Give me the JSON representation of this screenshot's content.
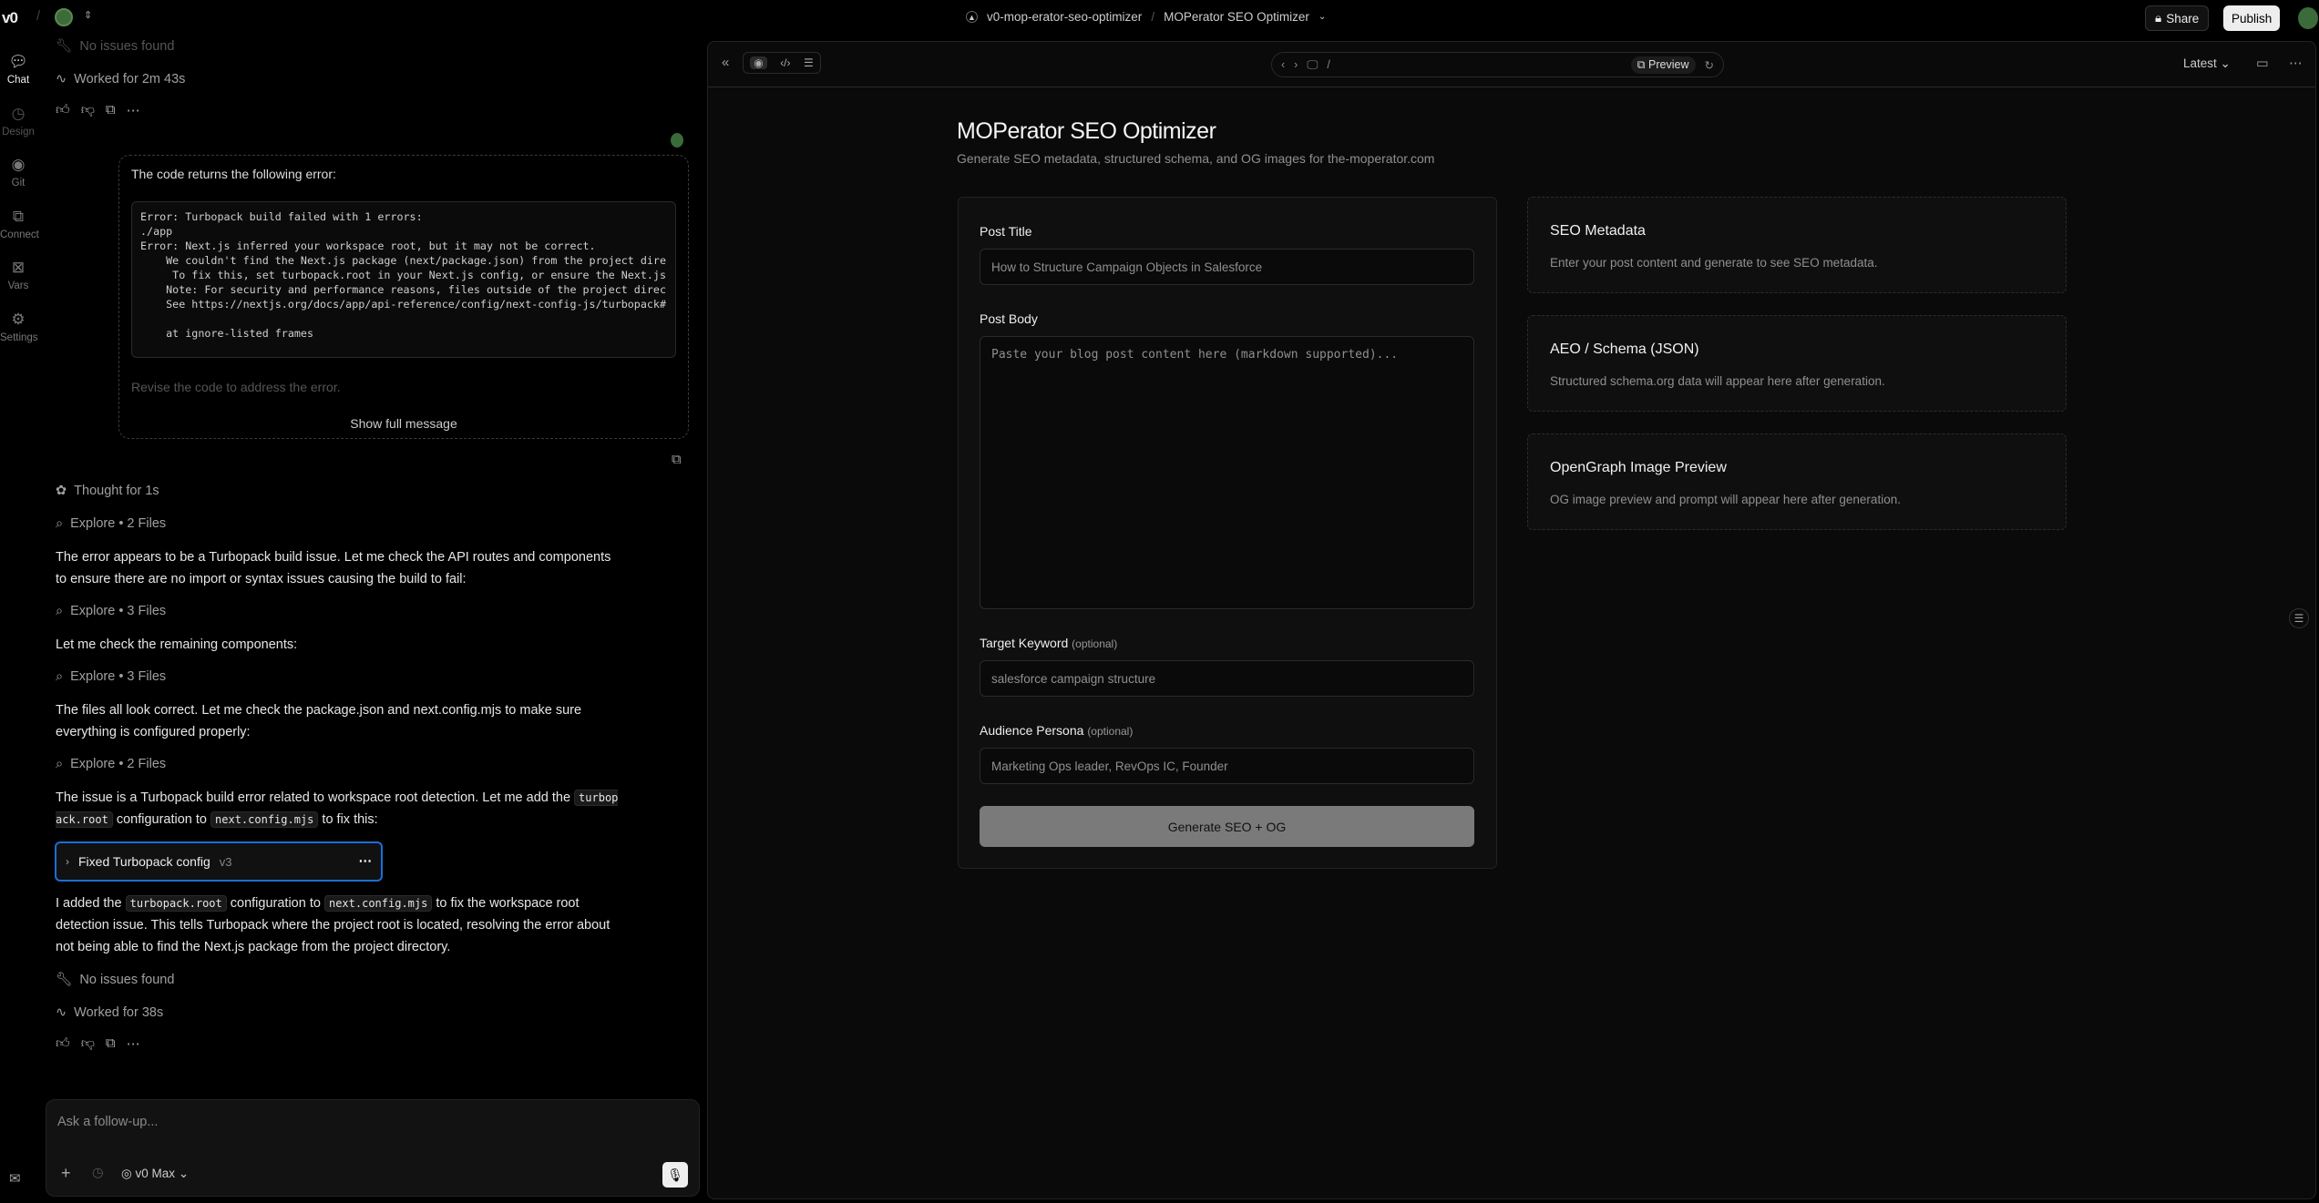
{
  "topbar": {
    "logo": "v0",
    "project": "v0-mop-erator-seo-optimizer",
    "page": "MOPerator SEO Optimizer",
    "share": "Share",
    "publish": "Publish"
  },
  "rail": [
    {
      "label": "Chat",
      "icon": "chat-icon"
    },
    {
      "label": "Design",
      "icon": "design-icon"
    },
    {
      "label": "Git",
      "icon": "github-icon"
    },
    {
      "label": "Connect",
      "icon": "connect-icon"
    },
    {
      "label": "Vars",
      "icon": "vars-icon"
    },
    {
      "label": "Settings",
      "icon": "gear-icon"
    }
  ],
  "chat": {
    "no_issues_top": "No issues found",
    "worked_top": "Worked for 2m 43s",
    "user_msg": {
      "intro": "The code returns the following error:",
      "error_lines": [
        "Error: Turbopack build failed with 1 errors:",
        "./app",
        "Error: Next.js inferred your workspace root, but it may not be correct.",
        "    We couldn't find the Next.js package (next/package.json) from the project dire",
        "     To fix this, set turbopack.root in your Next.js config, or ensure the Next.js",
        "    Note: For security and performance reasons, files outside of the project direc",
        "    See https://nextjs.org/docs/app/api-reference/config/next-config-js/turbopack#",
        "",
        "    at ignore-listed frames"
      ],
      "revise": "Revise the code to address the error.",
      "show_full": "Show full message"
    },
    "thought": "Thought for 1s",
    "explore1": "Explore • 2 Files",
    "para1": "The error appears to be a Turbopack build issue. Let me check the API routes and components to ensure there are no import or syntax issues causing the build to fail:",
    "explore2": "Explore • 3 Files",
    "para2": "Let me check the remaining components:",
    "explore3": "Explore • 3 Files",
    "para3": "The files all look correct. Let me check the package.json and next.config.mjs to make sure everything is configured properly:",
    "explore4": "Explore • 2 Files",
    "para4a": "The issue is a Turbopack build error related to workspace root detection. Let me add the ",
    "para4code1": "turbopack.root",
    "para4b": " configuration to ",
    "para4code2": "next.config.mjs",
    "para4c": " to fix this:",
    "version": {
      "title": "Fixed Turbopack config",
      "tag": "v3"
    },
    "para5a": "I added the ",
    "para5code1": "turbopack.root",
    "para5b": " configuration to ",
    "para5code2": "next.config.mjs",
    "para5c": " to fix the workspace root detection issue. This tells Turbopack where the project root is located, resolving the error about not being able to find the Next.js package from the project directory.",
    "no_issues": "No issues found",
    "worked": "Worked for 38s",
    "input_placeholder": "Ask a follow-up...",
    "model": "v0 Max"
  },
  "preview": {
    "path": "/",
    "preview_btn": "Preview",
    "version": "Latest",
    "title": "MOPerator SEO Optimizer",
    "subtitle": "Generate SEO metadata, structured schema, and OG images for the-moperator.com",
    "post_title_label": "Post Title",
    "post_title_value": "How to Structure Campaign Objects in Salesforce",
    "post_body_label": "Post Body",
    "post_body_placeholder": "Paste your blog post content here (markdown supported)...",
    "keyword_label": "Target Keyword",
    "optional": "(optional)",
    "keyword_value": "salesforce campaign structure",
    "persona_label": "Audience Persona",
    "persona_value": "Marketing Ops leader, RevOps IC, Founder",
    "generate": "Generate SEO + OG",
    "cards": [
      {
        "title": "SEO Metadata",
        "text": "Enter your post content and generate to see SEO metadata."
      },
      {
        "title": "AEO / Schema (JSON)",
        "text": "Structured schema.org data will appear here after generation."
      },
      {
        "title": "OpenGraph Image Preview",
        "text": "OG image preview and prompt will appear here after generation."
      }
    ]
  }
}
